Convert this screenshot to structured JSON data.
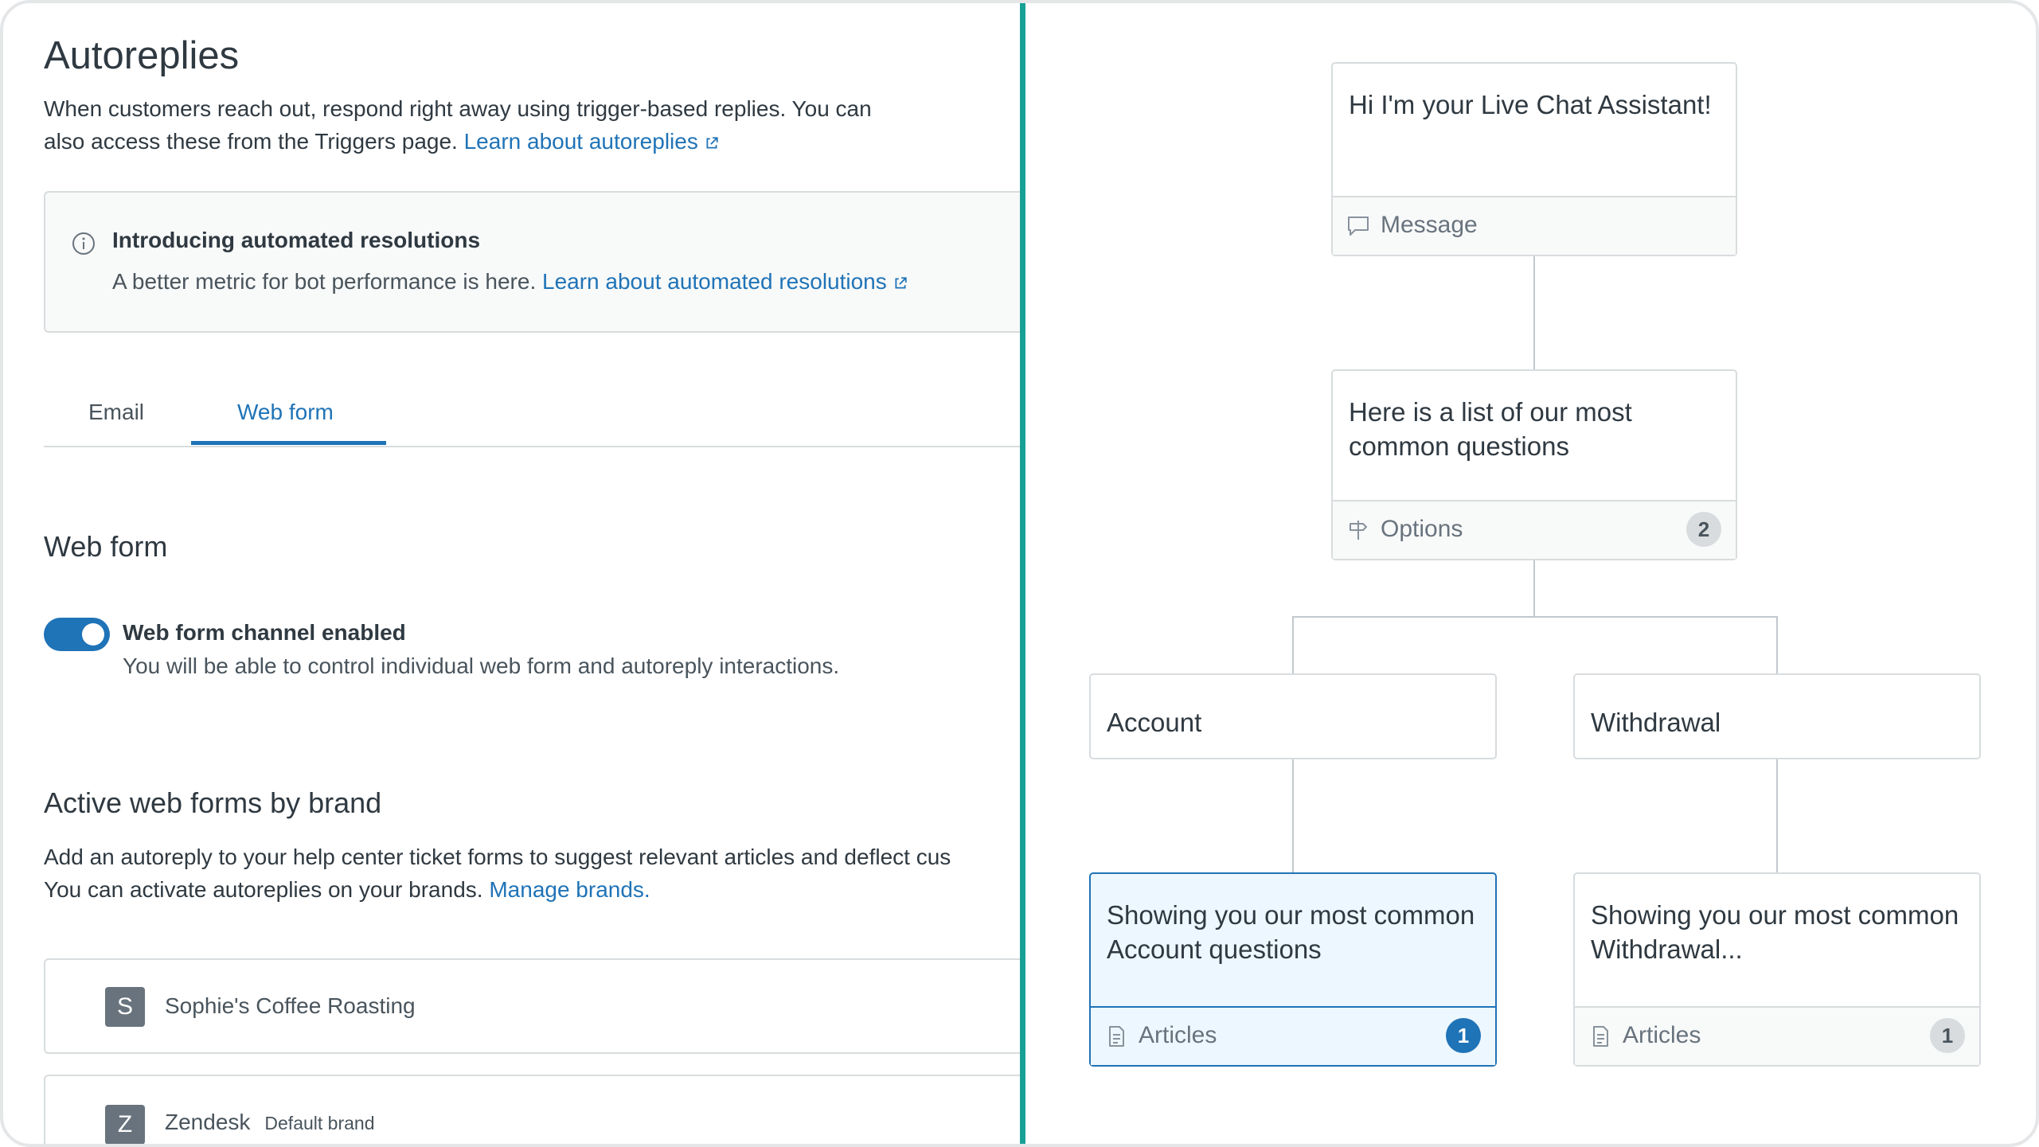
{
  "left": {
    "title": "Autoreplies",
    "description_line1": "When customers reach out, respond right away using trigger-based replies. You can",
    "description_line2": "also access these from the Triggers page.",
    "description_link": "Learn about autoreplies",
    "notice": {
      "title": "Introducing automated resolutions",
      "body": "A better metric for bot performance is here.",
      "link": "Learn about automated resolutions"
    },
    "tabs": [
      {
        "label": "Email",
        "active": false
      },
      {
        "label": "Web form",
        "active": true
      }
    ],
    "webform_heading": "Web form",
    "toggle": {
      "enabled": true,
      "label": "Web form channel enabled",
      "hint": "You will be able to control individual web form and autoreply interactions."
    },
    "active_heading": "Active web forms by brand",
    "active_desc_line1": "Add an autoreply to your help center ticket forms to suggest relevant articles and deflect cus",
    "active_desc_line2": "You can activate autoreplies on your brands.",
    "active_desc_link": "Manage brands.",
    "brands": [
      {
        "initial": "S",
        "name": "Sophie's Coffee Roasting",
        "tag": ""
      },
      {
        "initial": "Z",
        "name": "Zendesk",
        "tag": "Default brand"
      }
    ]
  },
  "flow": {
    "message_node": {
      "text": "Hi I'm your Live Chat Assistant!",
      "footer": "Message",
      "icon": "message-icon"
    },
    "options_node": {
      "text": "Here is a list of our most common questions",
      "footer": "Options",
      "count": "2",
      "icon": "options-icon"
    },
    "option_account": {
      "text": "Account"
    },
    "option_withdrawal": {
      "text": "Withdrawal"
    },
    "articles_account": {
      "text": "Showing you our most common Account questions",
      "footer": "Articles",
      "count": "1",
      "icon": "article-icon",
      "selected": true
    },
    "articles_withdrawal": {
      "text": "Showing you our most common Withdrawal...",
      "footer": "Articles",
      "count": "1",
      "icon": "article-icon",
      "selected": false
    }
  },
  "colors": {
    "accent": "#1f73b7",
    "divider": "#17a195",
    "selected_bg": "#edf7ff"
  }
}
